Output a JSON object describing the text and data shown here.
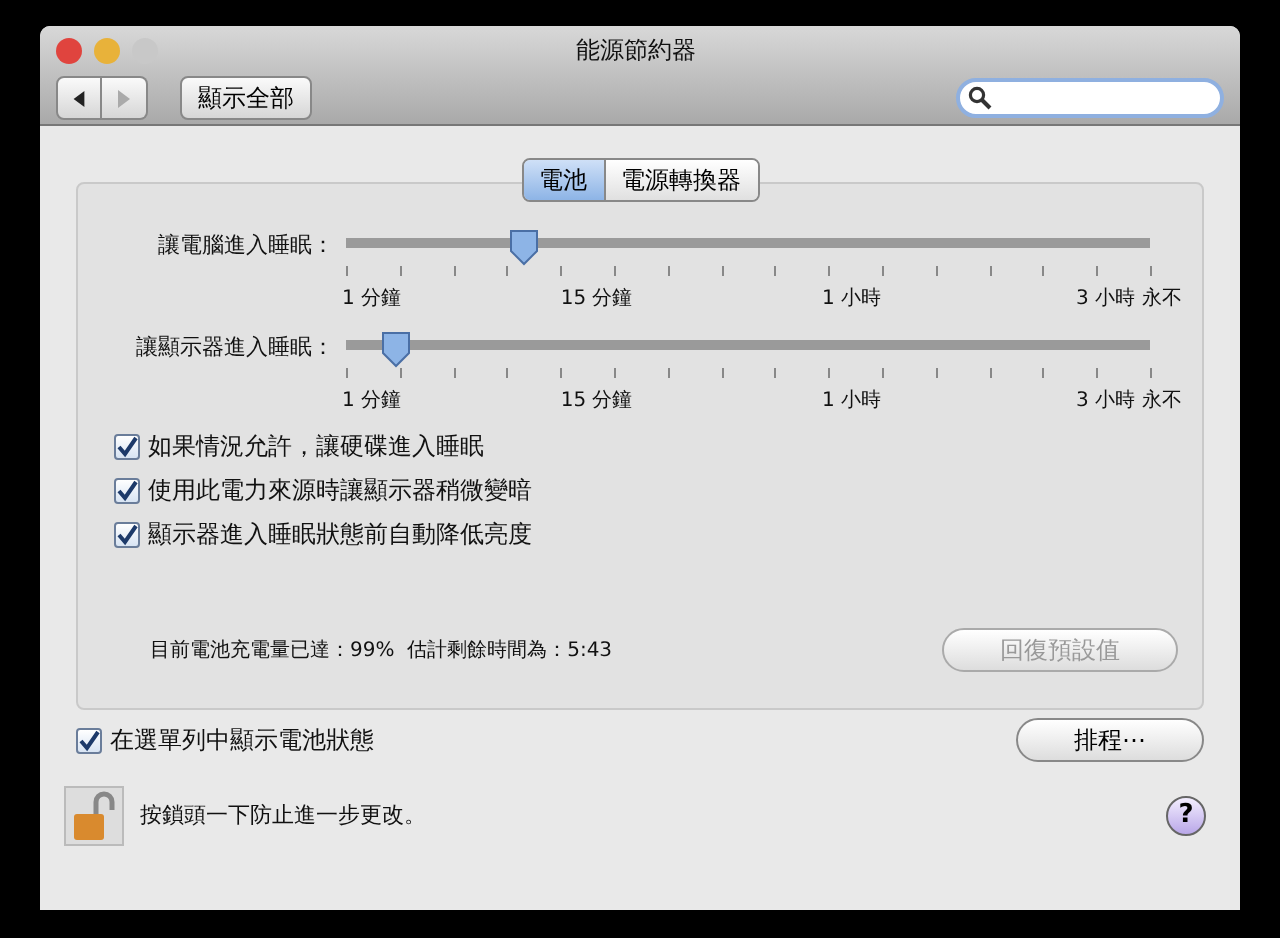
{
  "window": {
    "title": "能源節約器"
  },
  "toolbar": {
    "back": {
      "disabled": false
    },
    "forward": {
      "disabled": true
    },
    "show_all": "顯示全部"
  },
  "tabs": [
    {
      "label": "電池",
      "selected": true
    },
    {
      "label": "電源轉換器",
      "selected": false
    }
  ],
  "sliders": [
    {
      "label": "讓電腦進入睡眠：",
      "level": 0.21,
      "tick_labels": [
        "1 分鐘",
        "15 分鐘",
        "1 小時",
        "3 小時",
        "永不"
      ]
    },
    {
      "label": "讓顯示器進入睡眠：",
      "level": 0.045,
      "tick_labels": [
        "1 分鐘",
        "15 分鐘",
        "1 小時",
        "3 小時",
        "永不"
      ]
    }
  ],
  "options": [
    {
      "label": "如果情況允許，讓硬碟進入睡眠",
      "checked": true
    },
    {
      "label": "使用此電力來源時讓顯示器稍微變暗",
      "checked": true
    },
    {
      "label": "顯示器進入睡眠狀態前自動降低亮度",
      "checked": true
    }
  ],
  "battery_status": "目前電池充電量已達：99%  估計剩餘時間為：5:43",
  "restore_button": {
    "label": "回復預設值",
    "disabled": true
  },
  "menu_bar_option": {
    "label": "在選單列中顯示電池狀態",
    "checked": true
  },
  "schedule_button": "排程⋯",
  "lock_text": "按鎖頭一下防止進一步更改。",
  "help_button": "?"
}
